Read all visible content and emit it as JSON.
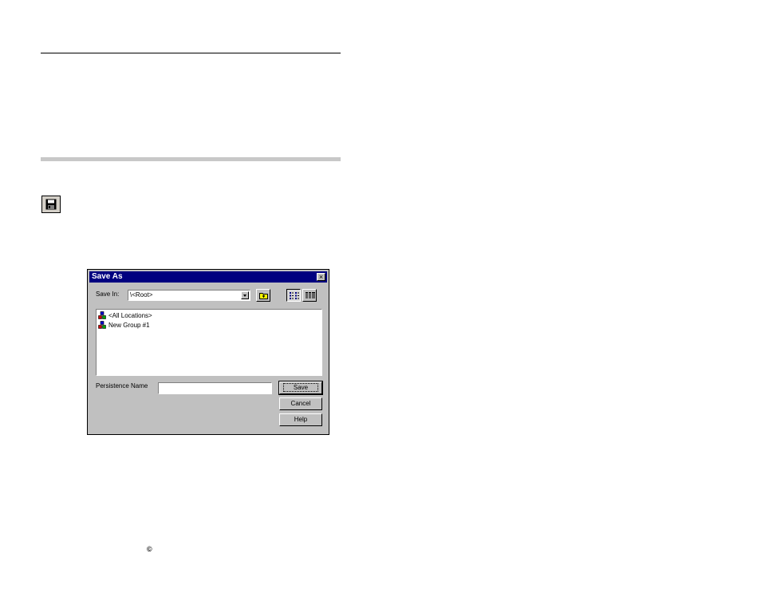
{
  "dialog": {
    "title": "Save As",
    "close_glyph": "×",
    "save_in_label": "Save In:",
    "save_in_value": "\\<Root>",
    "list_items": [
      {
        "label": "<All Locations>",
        "icon": "location-group-icon"
      },
      {
        "label": "New Group #1",
        "icon": "location-group-icon"
      }
    ],
    "persistence_name_label": "Persistence Name",
    "persistence_name_value": "",
    "buttons": {
      "save": "Save",
      "cancel": "Cancel",
      "help": "Help"
    }
  },
  "footer": {
    "copyright_symbol": "©"
  },
  "colors": {
    "titlebar": "#000080",
    "dialog_face": "#c0c0c0",
    "accent_gray": "#c8c8c8"
  }
}
